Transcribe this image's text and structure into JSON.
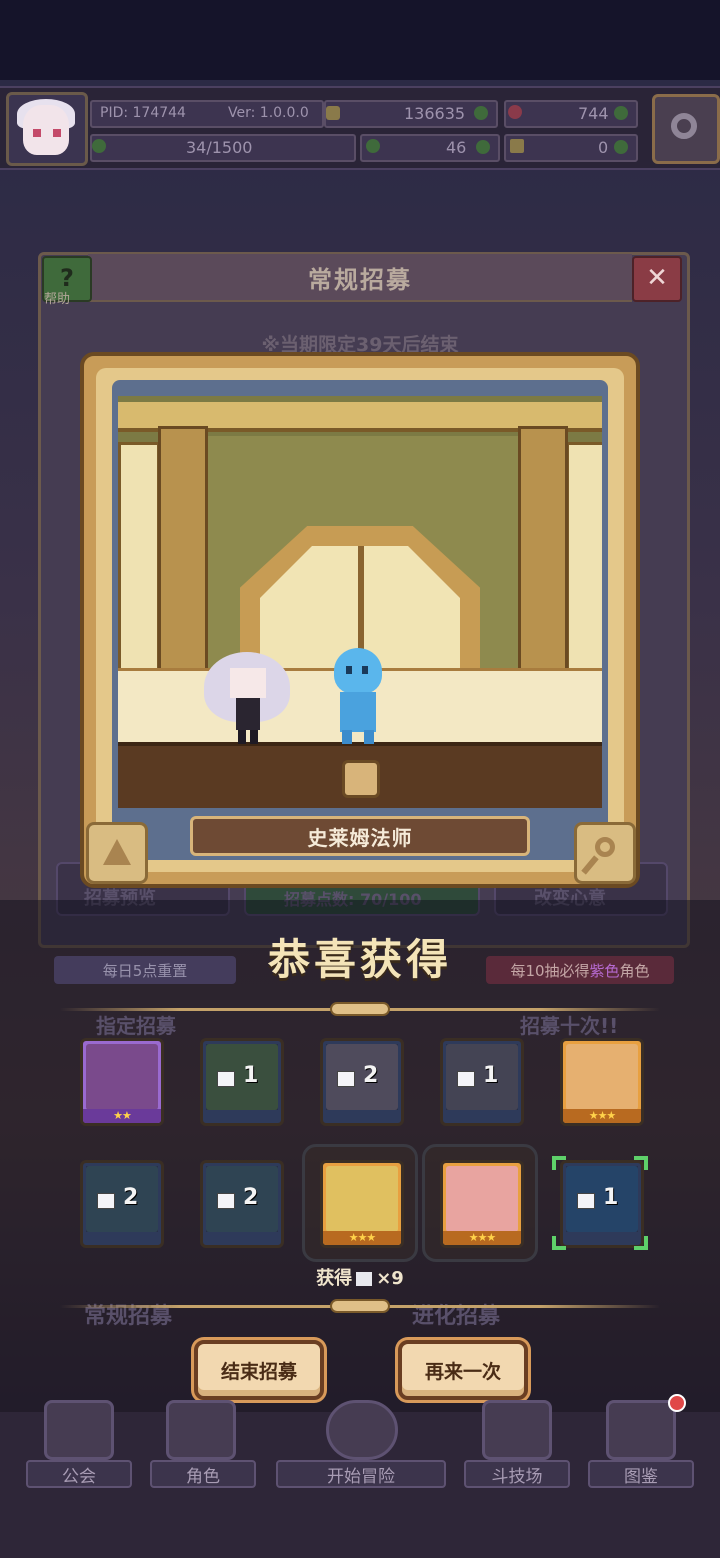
{
  "header": {
    "pid": "PID: 174744",
    "version": "Ver: 1.0.0.0",
    "gold": "136635",
    "gems": "744",
    "stamina": "34/1500",
    "clover": "46",
    "keys": "0"
  },
  "panel": {
    "title": "常规招募",
    "help_label": "帮助",
    "limit_notice": "※当期限定39天后结束",
    "character_name": "史莱姆法师",
    "ghost_preview": "招募预览",
    "ghost_points": "招募点数: 70/100",
    "ghost_mind": "改变心意",
    "reset_tag": "每日5点重置",
    "bonus_prefix": "每10抽必得",
    "bonus_color": "紫色",
    "bonus_suffix": "角色",
    "ghost_designate": "指定招募",
    "ghost_ten": "招募十次!!",
    "ghost_regular": "常规招募",
    "ghost_advanced": "进化招募"
  },
  "result": {
    "headline": "恭喜获得",
    "obtain_prefix": "获得",
    "obtain_count": "×9",
    "cards_row1": [
      {
        "kind": "character",
        "stars": "★★",
        "color": "#7a4a8c",
        "frame": "#9a6ad0"
      },
      {
        "kind": "shard",
        "count": "1",
        "color": "#4a6a4a"
      },
      {
        "kind": "shard",
        "count": "2",
        "color": "#6a6478"
      },
      {
        "kind": "shard",
        "count": "1",
        "color": "#5a5a6c"
      },
      {
        "kind": "character",
        "stars": "★★★",
        "color": "#e6b070",
        "frame": "#e8a040"
      }
    ],
    "cards_row2": [
      {
        "kind": "shard",
        "count": "2",
        "color": "#3a5a6a"
      },
      {
        "kind": "shard",
        "count": "2",
        "color": "#3a5a6a"
      },
      {
        "kind": "character",
        "stars": "★★★",
        "color": "#e0c060",
        "frame": "#e8a040"
      },
      {
        "kind": "character",
        "stars": "★★★",
        "color": "#e8a4a0",
        "frame": "#e8a040"
      },
      {
        "kind": "shard",
        "count": "1",
        "color": "#2a5a8a"
      }
    ]
  },
  "buttons": {
    "end": "结束招募",
    "again": "再来一次"
  },
  "nav": {
    "guild": "公会",
    "roles": "角色",
    "adventure": "开始冒险",
    "arena": "斗技场",
    "codex": "图鉴"
  }
}
